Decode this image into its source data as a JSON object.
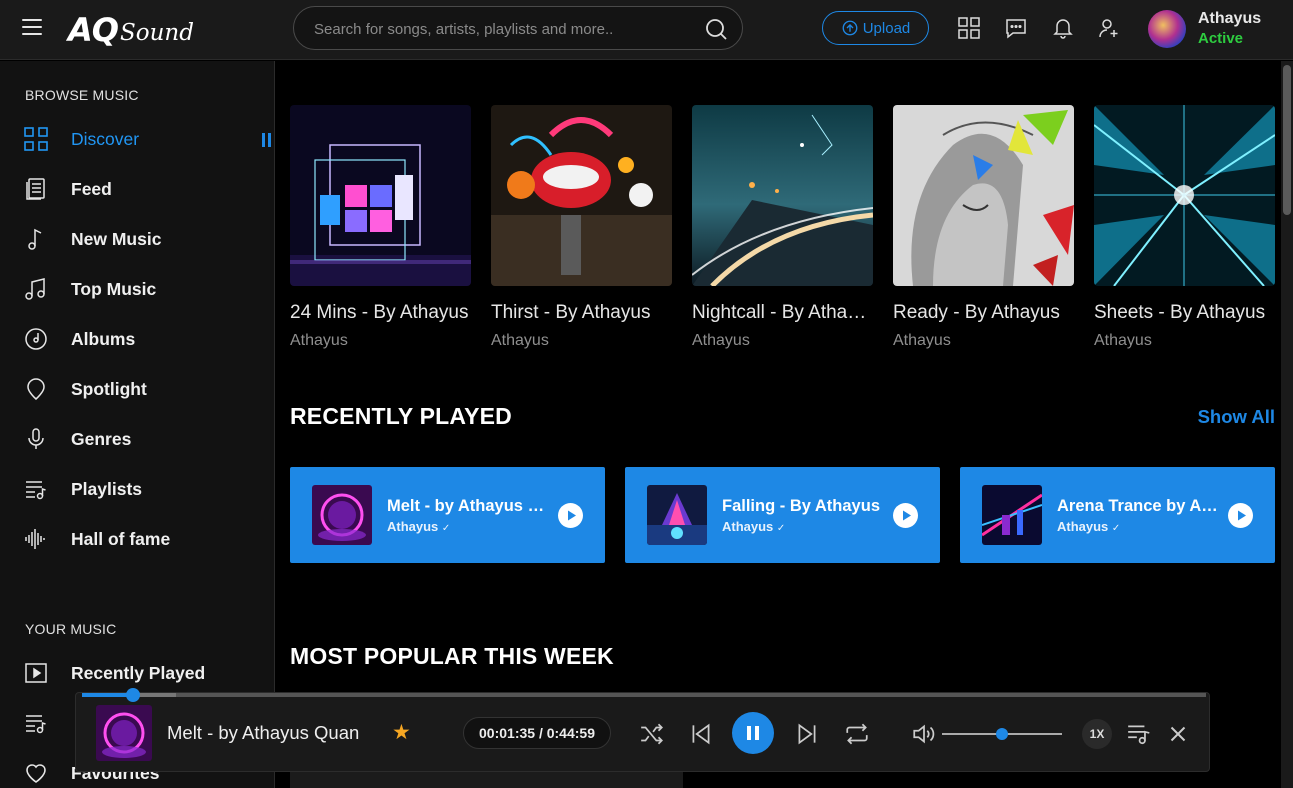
{
  "header": {
    "logo_main": "AQ",
    "logo_script": "Sound",
    "search_placeholder": "Search for songs, artists, playlists and more..",
    "upload_label": "Upload",
    "user": {
      "name": "Athayus",
      "status": "Active"
    }
  },
  "sidebar": {
    "browse_title": "BROWSE MUSIC",
    "browse_items": [
      {
        "label": "Discover",
        "icon": "grid-icon",
        "active": true
      },
      {
        "label": "Feed",
        "icon": "feed-icon"
      },
      {
        "label": "New Music",
        "icon": "music-note-icon"
      },
      {
        "label": "Top Music",
        "icon": "music-notes-icon"
      },
      {
        "label": "Albums",
        "icon": "album-icon"
      },
      {
        "label": "Spotlight",
        "icon": "spotlight-icon"
      },
      {
        "label": "Genres",
        "icon": "microphone-icon"
      },
      {
        "label": "Playlists",
        "icon": "playlist-icon"
      },
      {
        "label": "Hall of fame",
        "icon": "waveform-icon"
      }
    ],
    "your_music_title": "YOUR MUSIC",
    "your_music_items": [
      {
        "label": "Recently Played",
        "icon": "play-square-icon"
      },
      {
        "label": "",
        "icon": "playlist-icon"
      },
      {
        "label": "Favourites",
        "icon": "heart-icon"
      }
    ]
  },
  "main": {
    "albums": [
      {
        "title": "24 Mins - By Athayus",
        "artist": "Athayus"
      },
      {
        "title": "Thirst - By Athayus",
        "artist": "Athayus"
      },
      {
        "title": "Nightcall - By Athayus",
        "artist": "Athayus"
      },
      {
        "title": "Ready - By Athayus",
        "artist": "Athayus"
      },
      {
        "title": "Sheets - By Athayus",
        "artist": "Athayus"
      }
    ],
    "recently_played_title": "RECENTLY PLAYED",
    "show_all_label": "Show All",
    "recently_played": [
      {
        "title": "Melt - by Athayus Quan",
        "artist": "Athayus"
      },
      {
        "title": "Falling - By Athayus",
        "artist": "Athayus"
      },
      {
        "title": "Arena Trance by Athayus",
        "artist": "Athayus"
      }
    ],
    "most_popular_title": "MOST POPULAR THIS WEEK"
  },
  "player": {
    "track_title": "Melt - by Athayus Quan",
    "favourite_icon": "star-icon",
    "time_display": "00:01:35 / 0:44:59",
    "progress_fraction": 0.036,
    "volume_fraction": 0.5,
    "speed_label": "1X"
  },
  "colors": {
    "accent": "#1e88e5",
    "status_active": "#2ecc40",
    "star": "#f5a623"
  }
}
